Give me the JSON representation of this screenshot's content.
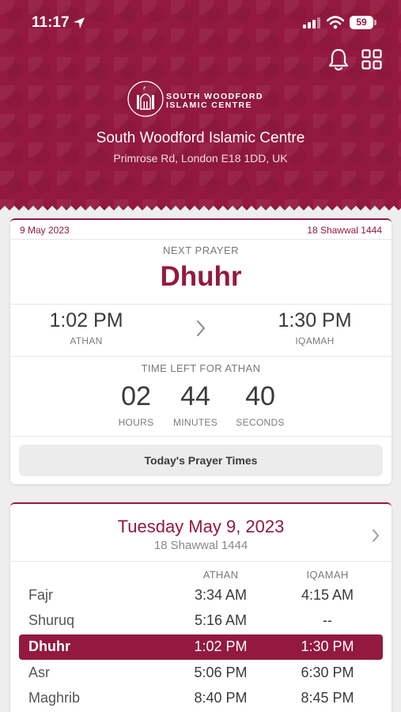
{
  "status_bar": {
    "time": "11:17",
    "battery": "59"
  },
  "header": {
    "logo_line1": "SOUTH WOODFORD",
    "logo_line2": "ISLAMIC CENTRE",
    "mosque_name": "South Woodford Islamic Centre",
    "address": "Primrose Rd, London E18 1DD, UK"
  },
  "next_prayer_card": {
    "gregorian_date": "9 May 2023",
    "hijri_date": "18 Shawwal 1444",
    "next_label": "NEXT PRAYER",
    "prayer_name": "Dhuhr",
    "athan_time": "1:02 PM",
    "athan_label": "ATHAN",
    "iqamah_time": "1:30 PM",
    "iqamah_label": "IQAMAH",
    "time_left_label": "TIME LEFT FOR ATHAN",
    "countdown": {
      "hours": "02",
      "hours_label": "HOURS",
      "minutes": "44",
      "minutes_label": "MINUTES",
      "seconds": "40",
      "seconds_label": "SECONDS"
    },
    "today_button": "Today's Prayer Times"
  },
  "timetable_card": {
    "day_title": "Tuesday May 9, 2023",
    "hijri": "18 Shawwal 1444",
    "col_athan": "ATHAN",
    "col_iqamah": "IQAMAH",
    "rows": [
      {
        "name": "Fajr",
        "athan": "3:34 AM",
        "iqamah": "4:15 AM"
      },
      {
        "name": "Shuruq",
        "athan": "5:16 AM",
        "iqamah": "--"
      },
      {
        "name": "Dhuhr",
        "athan": "1:02 PM",
        "iqamah": "1:30 PM"
      },
      {
        "name": "Asr",
        "athan": "5:06 PM",
        "iqamah": "6:30 PM"
      },
      {
        "name": "Maghrib",
        "athan": "8:40 PM",
        "iqamah": "8:45 PM"
      }
    ],
    "highlighted_prayer": "Dhuhr"
  },
  "colors": {
    "brand": "#931a3e",
    "background": "#eeeeee",
    "card": "#ffffff"
  }
}
